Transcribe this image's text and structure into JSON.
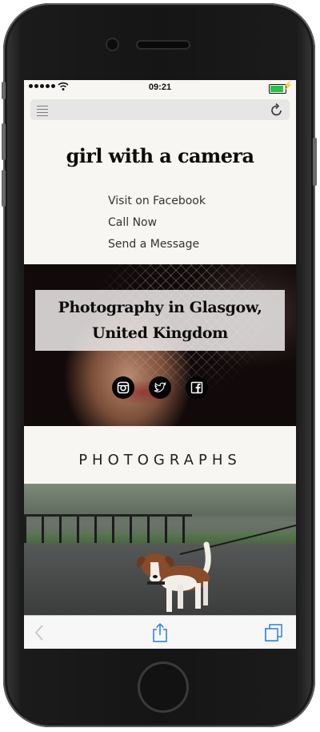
{
  "status_bar": {
    "time": "09:21",
    "signal_dots": 5,
    "battery_level": 0.9,
    "battery_color": "#27c24c"
  },
  "address_bar": {
    "left_icon": "reader-view-icon",
    "right_icon": "reload-icon"
  },
  "site": {
    "title": "girl with a camera",
    "nav": [
      {
        "label": "Visit on Facebook"
      },
      {
        "label": "Call Now"
      },
      {
        "label": "Send a Message"
      }
    ]
  },
  "hero": {
    "title_line1": "Photography in Glasgow,",
    "title_line2": "United Kingdom",
    "social_icons": [
      "instagram-icon",
      "twitter-icon",
      "facebook-icon"
    ]
  },
  "section": {
    "heading": "PHOTOGRAPHS"
  },
  "toolbar": {
    "icons": [
      "back-icon",
      "share-icon",
      "tabs-icon"
    ],
    "accent": "#2b7fe0"
  }
}
